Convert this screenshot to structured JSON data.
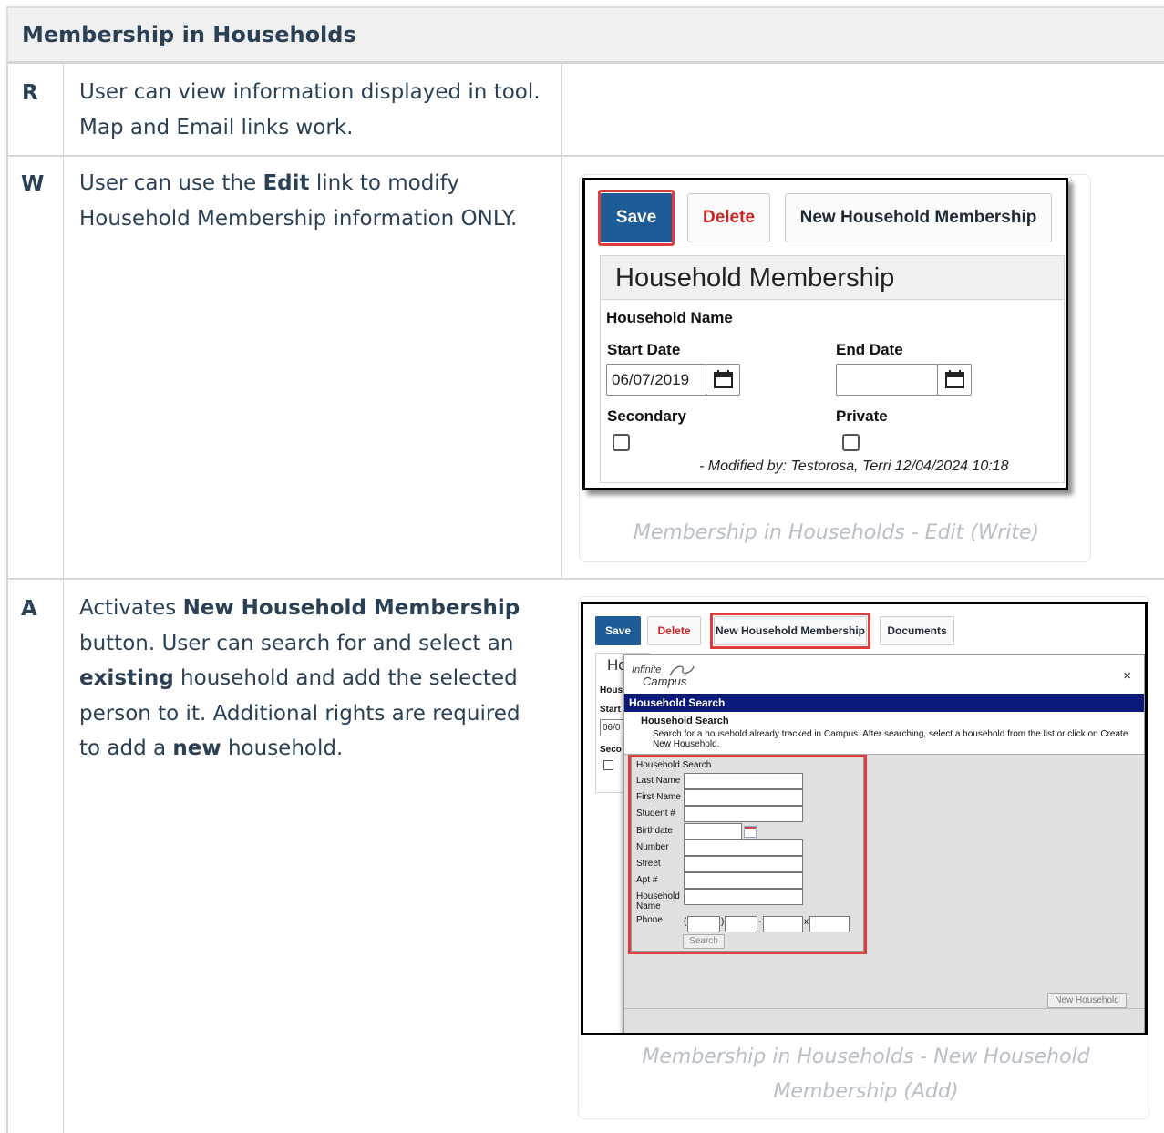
{
  "table_title": "Membership in Households",
  "rows": [
    {
      "letter": "R",
      "description_parts": [
        {
          "text": "User can view information displayed in tool. Map and Email links work.",
          "bold": false
        }
      ]
    },
    {
      "letter": "W",
      "description_parts": [
        {
          "text": "User can use the ",
          "bold": false
        },
        {
          "text": "Edit",
          "bold": true
        },
        {
          "text": " link to modify Household Membership information ONLY.",
          "bold": false
        }
      ],
      "caption": "Membership in Households - Edit (Write)"
    },
    {
      "letter": "A",
      "description_parts": [
        {
          "text": "Activates ",
          "bold": false
        },
        {
          "text": "New Household Membership",
          "bold": true
        },
        {
          "text": " button. User can search for and select an ",
          "bold": false
        },
        {
          "text": "existing",
          "bold": true
        },
        {
          "text": " household and add the selected person to it. Additional rights are required to add a ",
          "bold": false
        },
        {
          "text": "new",
          "bold": true
        },
        {
          "text": " household.",
          "bold": false
        }
      ],
      "caption": "Membership in Households - New Household Membership (Add)"
    }
  ],
  "edit_screenshot": {
    "buttons": {
      "save": "Save",
      "delete": "Delete",
      "new_membership": "New Household Membership"
    },
    "panel_title": "Household Membership",
    "labels": {
      "household_name": "Household Name",
      "start_date": "Start Date",
      "end_date": "End Date",
      "secondary": "Secondary",
      "private": "Private"
    },
    "start_date_value": "06/07/2019",
    "end_date_value": "",
    "modified_by": "- Modified by: Testorosa, Terri 12/04/2024 10:18",
    "colors": {
      "save_bg": "#1d5c96",
      "delete_text": "#cc2222",
      "highlight": "#e03c3c"
    }
  },
  "add_screenshot": {
    "buttons": {
      "save": "Save",
      "delete": "Delete",
      "new_membership": "New Household Membership",
      "documents": "Documents"
    },
    "underlay": {
      "title": "Ho",
      "labels": [
        "Hous",
        "Start",
        "Seco"
      ],
      "start_date_partial": "06/0"
    },
    "modal": {
      "logo_line1": "Infinite",
      "logo_line2": "Campus",
      "close_symbol": "×",
      "bar_title": "Household Search",
      "intro_title": "Household Search",
      "intro_text": "Search for a household already tracked in Campus. After searching, select a household from the list or click on Create New Household.",
      "form_title": "Household Search",
      "fields": [
        "Last Name",
        "First Name",
        "Student #",
        "Birthdate",
        "Number",
        "Street",
        "Apt #",
        "Household Name",
        "Phone"
      ],
      "phone_separators": [
        "(",
        ")",
        "-",
        "x"
      ],
      "search_button": "Search",
      "new_household_button": "New Household"
    },
    "colors": {
      "bar_bg": "#0b1a7a"
    }
  }
}
